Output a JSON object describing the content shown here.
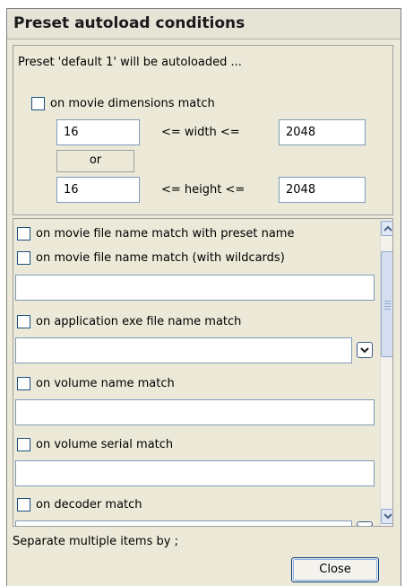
{
  "window": {
    "title": "Preset autoload conditions"
  },
  "intro_text": "Preset 'default 1' will be autoloaded ...",
  "dimensions": {
    "checkbox_label": "on movie dimensions match",
    "width_min": "16",
    "width_label": "<= width <=",
    "width_max": "2048",
    "or_label": "or",
    "height_min": "16",
    "height_label": "<= height <=",
    "height_max": "2048"
  },
  "conditions": {
    "file_name_preset": "on movie file name match with preset name",
    "file_name_wildcards": "on movie file name match (with wildcards)",
    "file_name_wildcards_value": "",
    "app_exe": "on application exe file name match",
    "app_exe_value": "",
    "volume_name": "on volume name match",
    "volume_name_value": "",
    "volume_serial": "on volume serial match",
    "volume_serial_value": "",
    "decoder": "on decoder match",
    "decoder_value": ""
  },
  "footer": {
    "hint": "Separate multiple items by ;",
    "close_label": "Close"
  },
  "icons": {
    "scroll_up": "scroll-up-arrow-icon",
    "scroll_down": "scroll-down-arrow-icon",
    "dropdown": "chevron-down-icon"
  },
  "colors": {
    "dialog_bg": "#ece9d8",
    "field_border": "#7f9db9",
    "checkbox_border": "#1c5180"
  }
}
